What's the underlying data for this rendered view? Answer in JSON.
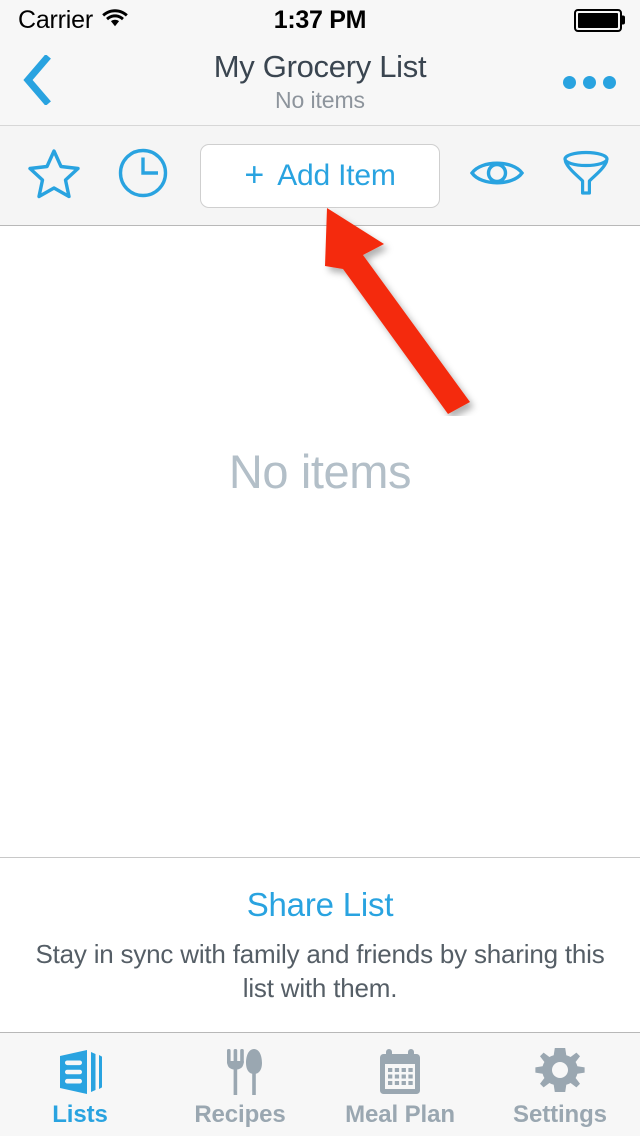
{
  "status_bar": {
    "carrier": "Carrier",
    "wifi_icon": "wifi-icon",
    "time": "1:37 PM",
    "battery_icon": "battery-full-icon"
  },
  "nav_bar": {
    "back_icon": "chevron-left-icon",
    "title": "My Grocery List",
    "subtitle": "No items",
    "more_icon": "more-options-icon"
  },
  "toolbar": {
    "favorite_icon": "star-icon",
    "recent_icon": "clock-icon",
    "add_item_plus": "+",
    "add_item_label": "Add Item",
    "view_icon": "eye-icon",
    "filter_icon": "funnel-icon"
  },
  "content": {
    "empty_state": "No items"
  },
  "annotation": {
    "arrow_icon": "red-arrow-pointer",
    "color": "#f42b0c",
    "points_to": "Add Item"
  },
  "share_section": {
    "title": "Share List",
    "description": "Stay in sync with family and friends by sharing this list with them."
  },
  "tab_bar": {
    "tabs": [
      {
        "label": "Lists",
        "icon": "lists-icon",
        "active": true
      },
      {
        "label": "Recipes",
        "icon": "fork-spoon-icon",
        "active": false
      },
      {
        "label": "Meal Plan",
        "icon": "calendar-icon",
        "active": false
      },
      {
        "label": "Settings",
        "icon": "gear-icon",
        "active": false
      }
    ]
  },
  "colors": {
    "accent": "#29a3e0",
    "title_text": "#3a4550",
    "muted_text": "#8d949c",
    "empty_text": "#b3bfc8",
    "tab_inactive": "#9aa7b1",
    "chrome_bg": "#f7f7f7",
    "annotation_red": "#f42b0c"
  }
}
